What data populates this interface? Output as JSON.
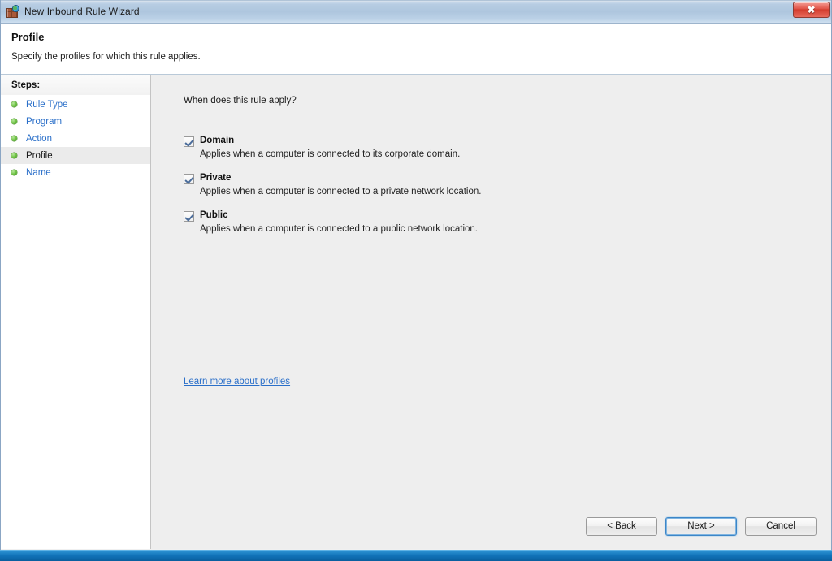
{
  "window": {
    "title": "New Inbound Rule Wizard",
    "icon": "firewall-brick-globe-icon",
    "close_label": "✖"
  },
  "header": {
    "title": "Profile",
    "subtitle": "Specify the profiles for which this rule applies."
  },
  "sidebar": {
    "heading": "Steps:",
    "items": [
      {
        "label": "Rule Type",
        "current": false
      },
      {
        "label": "Program",
        "current": false
      },
      {
        "label": "Action",
        "current": false
      },
      {
        "label": "Profile",
        "current": true
      },
      {
        "label": "Name",
        "current": false
      }
    ]
  },
  "main": {
    "prompt": "When does this rule apply?",
    "options": [
      {
        "label": "Domain",
        "checked": true,
        "description": "Applies when a computer is connected to its corporate domain."
      },
      {
        "label": "Private",
        "checked": true,
        "description": "Applies when a computer is connected to a private network location."
      },
      {
        "label": "Public",
        "checked": true,
        "description": "Applies when a computer is connected to a public network location."
      }
    ],
    "learn_more": "Learn more about profiles"
  },
  "footer": {
    "back": "< Back",
    "next": "Next >",
    "cancel": "Cancel"
  },
  "colors": {
    "link": "#2a6fc9",
    "titlebar": "#b8cde3",
    "pane": "#eeeeee",
    "check": "#4a6c9b",
    "close": "#d33c2e",
    "step_dot": "#69bf3e"
  }
}
